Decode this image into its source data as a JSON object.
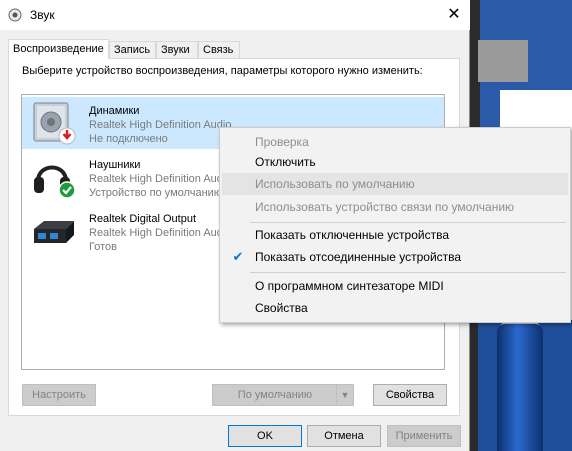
{
  "window": {
    "title": "Звук",
    "close_glyph": "✕"
  },
  "tabs": [
    {
      "label": "Воспроизведение"
    },
    {
      "label": "Запись"
    },
    {
      "label": "Звуки"
    },
    {
      "label": "Связь"
    }
  ],
  "instruction": "Выберите устройство воспроизведения, параметры которого нужно изменить:",
  "devices": [
    {
      "name": "Динамики",
      "driver": "Realtek High Definition Audio",
      "status": "Не подключено",
      "icon": "speaker-icon",
      "badge": "red-down-arrow"
    },
    {
      "name": "Наушники",
      "driver": "Realtek High Definition Audio",
      "status": "Устройство по умолчанию",
      "icon": "headphones-icon",
      "badge": "green-check"
    },
    {
      "name": "Realtek Digital Output",
      "driver": "Realtek High Definition Audio",
      "status": "Готов",
      "icon": "digital-output-icon",
      "badge": ""
    }
  ],
  "buttons": {
    "configure": "Настроить",
    "set_default": "По умолчанию",
    "properties": "Свойства",
    "ok": "OK",
    "cancel": "Отмена",
    "apply": "Применить"
  },
  "context_menu": [
    {
      "label": "Проверка",
      "disabled": true
    },
    {
      "label": "Отключить",
      "disabled": false
    },
    {
      "label": "Использовать по умолчанию",
      "disabled": true
    },
    {
      "label": "Использовать устройство связи по умолчанию",
      "disabled": true
    },
    {
      "label": "Показать отключенные устройства",
      "disabled": false
    },
    {
      "label": "Показать отсоединенные устройства",
      "disabled": false,
      "checked": true
    },
    {
      "label": "О программном синтезаторе MIDI",
      "disabled": false
    },
    {
      "label": "Свойства",
      "disabled": false
    }
  ],
  "colors": {
    "selection": "#cce8ff",
    "accent": "#0078d7"
  }
}
